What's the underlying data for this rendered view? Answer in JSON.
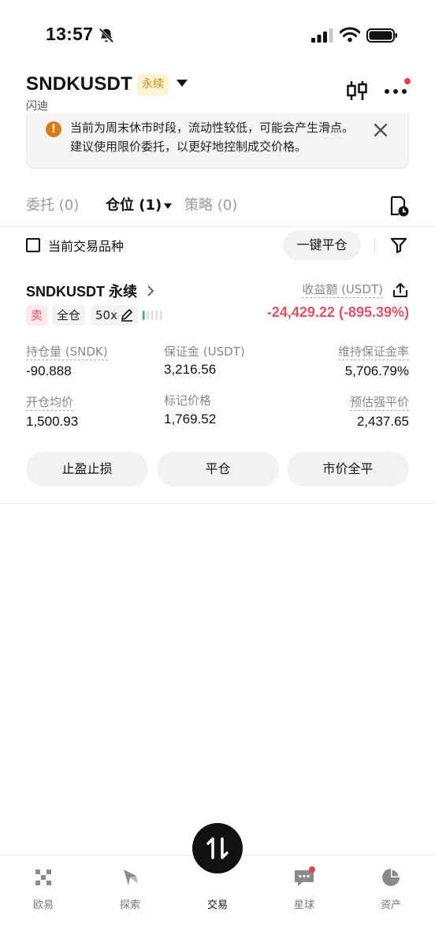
{
  "status_bar": {
    "time": "13:57"
  },
  "header": {
    "symbol": "SNDKUSDT",
    "badge": "永续",
    "subtitle": "闪迪"
  },
  "notice": {
    "text": "当前为周末休市时段，流动性较低，可能会产生滑点。建议使用限价委托，以更好地控制成交价格。"
  },
  "tabs": [
    {
      "label": "委托 (0)"
    },
    {
      "label": "仓位 (1)"
    },
    {
      "label": "策略 (0)"
    }
  ],
  "filter": {
    "checkbox_label": "当前交易品种",
    "close_all_label": "一键平仓"
  },
  "position": {
    "symbol": "SNDKUSDT 永续",
    "pnl_label": "收益额 (USDT)",
    "pnl_value": "-24,429.22 (-895.39%)",
    "side_tag": "卖",
    "margin_mode": "全仓",
    "leverage": "50x",
    "risk_level_fraction": 0.2,
    "metrics": [
      {
        "label": "持仓量 (SNDK)",
        "value": "-90.888"
      },
      {
        "label": "保证金 (USDT)",
        "value": "3,216.56"
      },
      {
        "label": "维持保证金率",
        "value": "5,706.79%"
      },
      {
        "label": "开仓均价",
        "value": "1,500.93"
      },
      {
        "label": "标记价格",
        "value": "1,769.52"
      },
      {
        "label": "预估强平价",
        "value": "2,437.65"
      }
    ],
    "actions": [
      {
        "label": "止盈止损"
      },
      {
        "label": "平仓"
      },
      {
        "label": "市价全平"
      }
    ]
  },
  "bottom_nav": [
    {
      "label": "欧易",
      "icon": "okx-logo-icon"
    },
    {
      "label": "探索",
      "icon": "compass-icon"
    },
    {
      "label": "交易",
      "icon": "trade-swap-icon"
    },
    {
      "label": "星球",
      "icon": "chat-icon"
    },
    {
      "label": "资产",
      "icon": "pie-chart-icon"
    }
  ],
  "colors": {
    "accent_red": "#e84f67",
    "badge_bg": "#fdf1d6",
    "badge_text": "#d08a18",
    "warning_orange": "#d97918",
    "risk_green": "#2bb673"
  }
}
